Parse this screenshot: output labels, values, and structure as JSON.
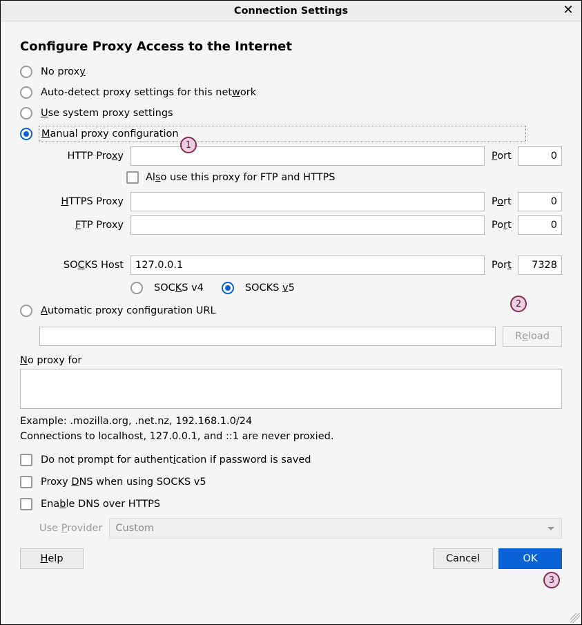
{
  "title": "Connection Settings",
  "heading": "Configure Proxy Access to the Internet",
  "proxy_mode": {
    "no_proxy_pre": "No prox",
    "no_proxy_u": "y",
    "autodetect_pre": "Auto-detect proxy settings for this net",
    "autodetect_u": "w",
    "autodetect_post": "ork",
    "system_u": "U",
    "system_post": "se system proxy settings",
    "manual_u": "M",
    "manual_post": "anual proxy configuration",
    "autoconf_u": "A",
    "autoconf_post": "utomatic proxy configuration URL"
  },
  "http": {
    "label_pre": "HTTP Pro",
    "label_u": "x",
    "label_post": "y",
    "value": "",
    "port_label_u": "P",
    "port_label_post": "ort",
    "port_value": "0"
  },
  "also_ftp_https": {
    "pre": "Al",
    "u": "s",
    "post": "o use this proxy for FTP and HTTPS"
  },
  "https": {
    "label_u": "H",
    "label_post": "TTPS Proxy",
    "value": "",
    "port_label_pre": "P",
    "port_label_u": "o",
    "port_label_post": "rt",
    "port_value": "0"
  },
  "ftp": {
    "label_u": "F",
    "label_post": "TP Proxy",
    "value": "",
    "port_label_pre": "Po",
    "port_label_u": "r",
    "port_label_post": "t",
    "port_value": "0"
  },
  "socks": {
    "label_pre": "SO",
    "label_u": "C",
    "label_post": "KS Host",
    "value": "127.0.0.1",
    "port_label_pre": "Por",
    "port_label_u": "t",
    "port_value": "7328",
    "v4_pre": "SOC",
    "v4_u": "K",
    "v4_post": "S v4",
    "v5_pre": "SOCKS ",
    "v5_u": "v",
    "v5_post": "5"
  },
  "autoconf": {
    "value": ""
  },
  "reload_pre": "R",
  "reload_u": "e",
  "reload_post": "load",
  "no_proxy_for": {
    "label_u": "N",
    "label_post": "o proxy for",
    "value": "",
    "example": "Example: .mozilla.org, .net.nz, 192.168.1.0/24",
    "note": "Connections to localhost, 127.0.0.1, and ::1 are never proxied."
  },
  "checks": {
    "noprompt_pre": "Do not prompt for authent",
    "noprompt_u": "i",
    "noprompt_post": "cation if password is saved",
    "proxydns_pre": "Proxy ",
    "proxydns_u": "D",
    "proxydns_post": "NS when using SOCKS v5",
    "doh_pre": "Ena",
    "doh_u": "b",
    "doh_post": "le DNS over HTTPS"
  },
  "provider": {
    "label_pre": "Use ",
    "label_u": "P",
    "label_post": "rovider",
    "selected": "Custom"
  },
  "buttons": {
    "help_u": "H",
    "help_post": "elp",
    "cancel": "Cancel",
    "ok": "OK"
  },
  "markers": {
    "m1": "1",
    "m2": "2",
    "m3": "3"
  }
}
